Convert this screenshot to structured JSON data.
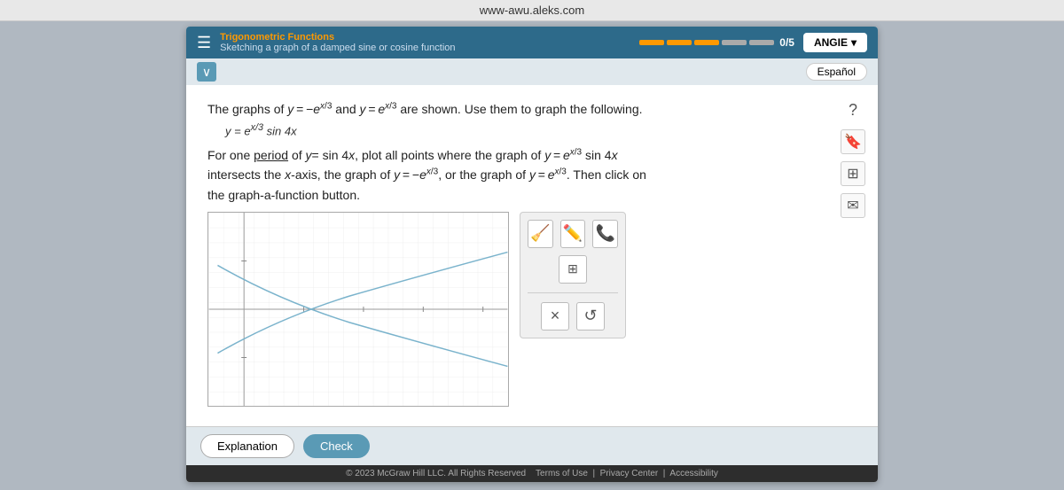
{
  "browser": {
    "url": "www-awu.aleks.com"
  },
  "header": {
    "module": "Trigonometric Functions",
    "subtitle": "Sketching a graph of a damped sine or cosine function",
    "progress_label": "0/5",
    "user": "ANGIE"
  },
  "espanol_label": "Español",
  "problem": {
    "intro": "The graphs of y = −e",
    "exp1": "x",
    "exp1_denom": "3",
    "and_text": "and",
    "intro2": "y = e",
    "exp2": "x",
    "exp2_denom": "3",
    "suffix": "are shown. Use them to graph the following.",
    "function_label": "y = e",
    "function_exp": "x",
    "function_exp_denom": "3",
    "function_suffix": "sin 4x",
    "instruction_pre": "For one",
    "period_underlined": "period",
    "instruction_mid": "of y= sin 4x, plot all points where the graph of y = e",
    "instruction_exp": "x",
    "instruction_exp_denom": "3",
    "instruction_sin": "sin 4x",
    "instruction_post": "intersects the x-axis, the graph of y = −e",
    "neg_exp": "x",
    "neg_exp_denom": "3",
    "instruction_or": ", or the graph of y = e",
    "pos_exp": "x",
    "pos_exp_denom": "3",
    "then_click": ". Then click on",
    "graph_a_function": "the graph-a-function button."
  },
  "toolbar": {
    "question_icon": "?",
    "bookmark_icon": "🔖",
    "grid_icon": "⊞",
    "mail_icon": "✉"
  },
  "tools": {
    "eraser_label": "eraser",
    "pencil_label": "pencil",
    "phone_label": "phone",
    "grid_label": "grid",
    "cross_label": "×",
    "refresh_label": "↺"
  },
  "footer": {
    "explanation_label": "Explanation",
    "check_label": "Check"
  },
  "copyright": "© 2023 McGraw Hill LLC. All Rights Reserved",
  "links": {
    "terms": "Terms of Use",
    "privacy": "Privacy Center",
    "accessibility": "Accessibility"
  }
}
